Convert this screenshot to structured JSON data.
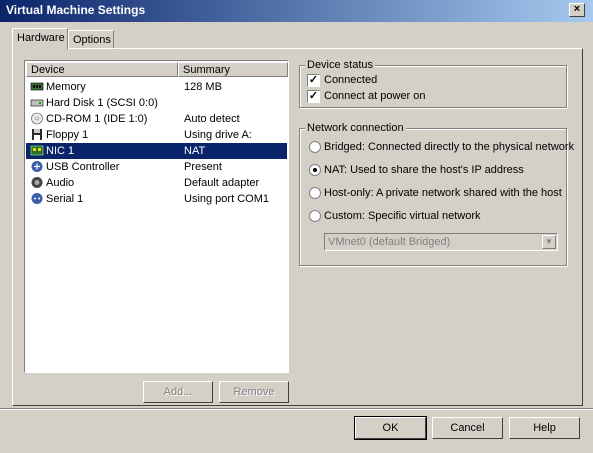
{
  "window": {
    "title": "Virtual Machine Settings",
    "close_glyph": "×"
  },
  "tabs": [
    {
      "label": "Hardware"
    },
    {
      "label": "Options"
    }
  ],
  "device_list": {
    "columns": {
      "device": "Device",
      "summary": "Summary"
    },
    "rows": [
      {
        "device": "Memory",
        "summary": "128 MB",
        "icon": "memory-icon"
      },
      {
        "device": "Hard Disk 1 (SCSI 0:0)",
        "summary": "",
        "icon": "hard-disk-icon"
      },
      {
        "device": "CD-ROM 1 (IDE 1:0)",
        "summary": "Auto detect",
        "icon": "cdrom-icon"
      },
      {
        "device": "Floppy 1",
        "summary": "Using drive A:",
        "icon": "floppy-icon"
      },
      {
        "device": "NIC 1",
        "summary": "NAT",
        "icon": "nic-icon",
        "selected": true
      },
      {
        "device": "USB Controller",
        "summary": "Present",
        "icon": "usb-icon"
      },
      {
        "device": "Audio",
        "summary": "Default adapter",
        "icon": "audio-icon"
      },
      {
        "device": "Serial 1",
        "summary": "Using port COM1",
        "icon": "serial-icon"
      }
    ]
  },
  "list_buttons": {
    "add": "Add...",
    "remove": "Remove"
  },
  "device_status": {
    "label": "Device status",
    "connected": {
      "label": "Connected",
      "checked": true
    },
    "connect_at_power_on": {
      "label": "Connect at power on",
      "checked": true
    }
  },
  "network_connection": {
    "label": "Network connection",
    "options": [
      {
        "label": "Bridged: Connected directly to the physical network",
        "selected": false
      },
      {
        "label": "NAT: Used to share the host's IP address",
        "selected": true
      },
      {
        "label": "Host-only: A private network shared with the host",
        "selected": false
      },
      {
        "label": "Custom: Specific virtual network",
        "selected": false
      }
    ],
    "custom_network_select": {
      "value": "VMnet0 (default Bridged)"
    }
  },
  "footer": {
    "ok": "OK",
    "cancel": "Cancel",
    "help": "Help"
  },
  "colors": {
    "face": "#d4d0c8",
    "selection": "#0a246a",
    "title_start": "#0a246a",
    "title_end": "#a6caf0"
  }
}
